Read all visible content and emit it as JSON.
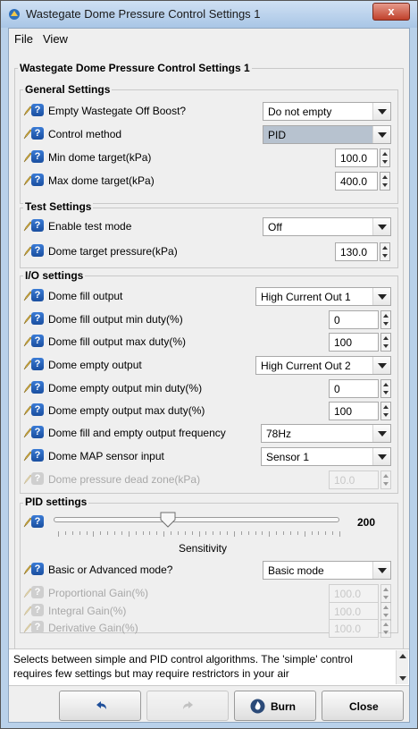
{
  "window": {
    "title": "Wastegate Dome Pressure Control Settings 1",
    "close_label": "x"
  },
  "menu": {
    "file": "File",
    "view": "View"
  },
  "panel_title": "Wastegate Dome Pressure Control Settings 1",
  "groups": {
    "general": "General Settings",
    "test": "Test Settings",
    "io": "I/O settings",
    "pid": "PID settings"
  },
  "general": {
    "empty_off_boost": {
      "label": "Empty Wastegate Off Boost?",
      "value": "Do not empty"
    },
    "control_method": {
      "label": "Control method",
      "value": "PID"
    },
    "min_dome": {
      "label": "Min dome target(kPa)",
      "value": "100.0"
    },
    "max_dome": {
      "label": "Max dome target(kPa)",
      "value": "400.0"
    }
  },
  "test": {
    "enable": {
      "label": "Enable test mode",
      "value": "Off"
    },
    "target": {
      "label": "Dome target pressure(kPa)",
      "value": "130.0"
    }
  },
  "io": {
    "fill_output": {
      "label": "Dome fill output",
      "value": "High Current Out 1"
    },
    "fill_min": {
      "label": "Dome fill output min duty(%)",
      "value": "0"
    },
    "fill_max": {
      "label": "Dome fill output max duty(%)",
      "value": "100"
    },
    "empty_output": {
      "label": "Dome empty output",
      "value": "High Current Out 2"
    },
    "empty_min": {
      "label": "Dome empty output min duty(%)",
      "value": "0"
    },
    "empty_max": {
      "label": "Dome empty output max duty(%)",
      "value": "100"
    },
    "frequency": {
      "label": "Dome fill and empty output frequency",
      "value": "78Hz"
    },
    "map_sensor": {
      "label": "Dome MAP sensor input",
      "value": "Sensor 1"
    },
    "dead_zone": {
      "label": "Dome pressure dead zone(kPa)",
      "value": "10.0"
    }
  },
  "pid": {
    "sensitivity_value": "200",
    "sensitivity_fraction": 0.4,
    "sensitivity_label": "Sensitivity",
    "mode": {
      "label": "Basic or Advanced mode?",
      "value": "Basic mode"
    },
    "proportional": {
      "label": "Proportional Gain(%)",
      "value": "100.0"
    },
    "integral": {
      "label": "Integral Gain(%)",
      "value": "100.0"
    },
    "derivative": {
      "label": "Derivative Gain(%)",
      "value": "100.0"
    }
  },
  "status_text": "Selects between simple and PID control algorithms. The 'simple' control requires few settings but may require restrictors in your air",
  "buttons": {
    "burn": "Burn",
    "close": "Close"
  },
  "colors": {
    "help_icon": "#1a4fa0",
    "window_frame": "#b9d1ea",
    "highlight_select": "#b7c2cf"
  }
}
